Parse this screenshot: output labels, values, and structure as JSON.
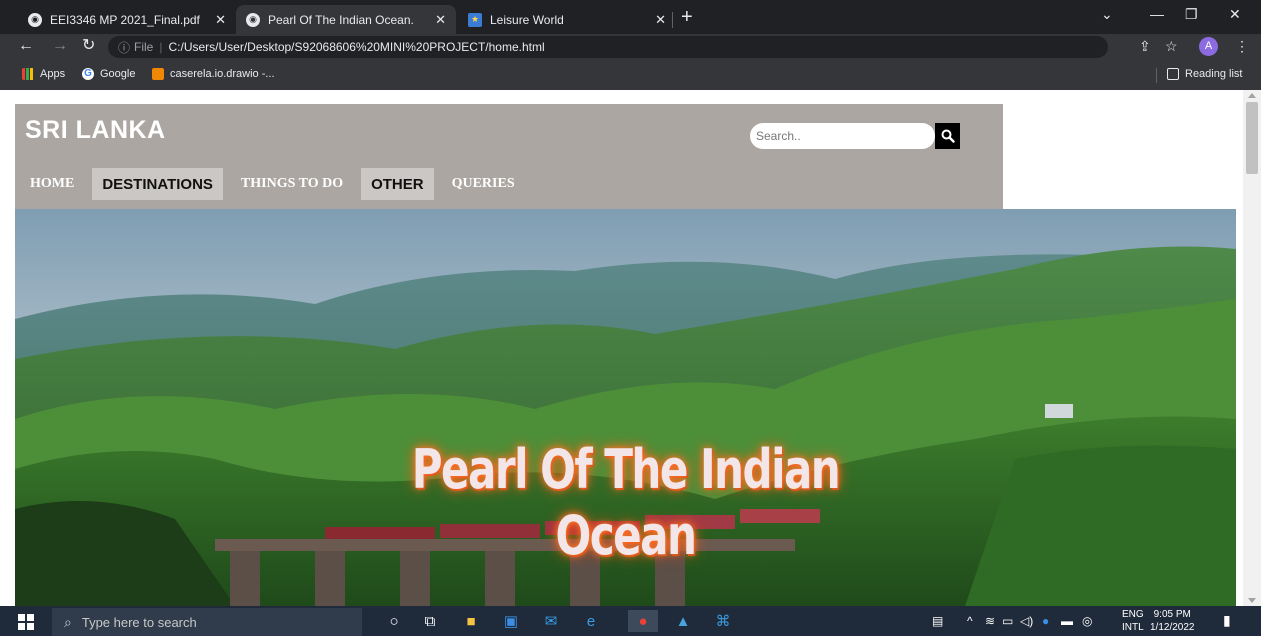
{
  "browser": {
    "tabs": [
      {
        "title": "EEI3346 MP 2021_Final.pdf",
        "active": false
      },
      {
        "title": "Pearl Of The Indian Ocean.",
        "active": true
      },
      {
        "title": "Leisure World",
        "active": false
      }
    ],
    "new_tab": "+",
    "address": {
      "info_icon": "ⓘ",
      "scheme_label": "File",
      "url": "C:/Users/User/Desktop/S92068606%20MINI%20PROJECT/home.html"
    },
    "profile_initial": "A",
    "bookmarks": [
      {
        "label": "Apps"
      },
      {
        "label": "Google"
      },
      {
        "label": "caserela.io.drawio -..."
      }
    ],
    "reading_list": "Reading list"
  },
  "page": {
    "site_title": "SRI LANKA",
    "search": {
      "placeholder": "Search.."
    },
    "nav": [
      {
        "label": "HOME"
      },
      {
        "label": "DESTINATIONS"
      },
      {
        "label": "THINGS TO DO"
      },
      {
        "label": "OTHER"
      },
      {
        "label": "QUERIES"
      }
    ],
    "hero": {
      "line1": "Pearl Of The Indian",
      "line2": "Ocean"
    }
  },
  "taskbar": {
    "search_placeholder": "Type here to search",
    "lang_top": "ENG",
    "lang_bottom": "INTL",
    "time": "9:05 PM",
    "date": "1/12/2022"
  }
}
